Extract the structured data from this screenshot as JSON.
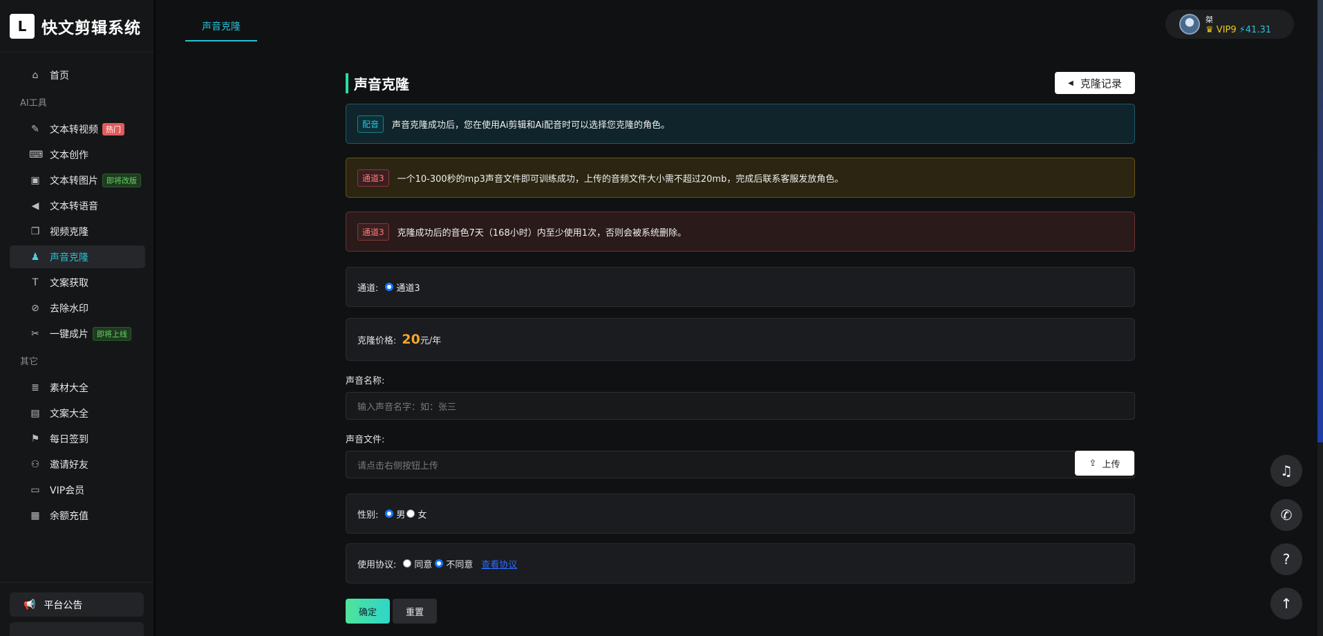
{
  "app": {
    "logo_mark": "L",
    "title": "快文剪辑系统"
  },
  "sidebar": {
    "items": [
      {
        "label": "首页",
        "icon": "home-icon",
        "glyph": "⌂"
      },
      {
        "group": "AI工具"
      },
      {
        "label": "文本转视频",
        "icon": "magic-wand-icon",
        "glyph": "✎",
        "badge": "热门",
        "badge_type": "hot"
      },
      {
        "label": "文本创作",
        "icon": "keyboard-icon",
        "glyph": "⌨"
      },
      {
        "label": "文本转图片",
        "icon": "image-icon",
        "glyph": "▣",
        "badge": "即将改版",
        "badge_type": "soon"
      },
      {
        "label": "文本转语音",
        "icon": "speaker-icon",
        "glyph": "◀"
      },
      {
        "label": "视频克隆",
        "icon": "copy-icon",
        "glyph": "❐"
      },
      {
        "label": "声音克隆",
        "icon": "users-icon",
        "glyph": "♟",
        "active": true
      },
      {
        "label": "文案获取",
        "icon": "text-height-icon",
        "glyph": "T"
      },
      {
        "label": "去除水印",
        "icon": "no-droplet-icon",
        "glyph": "⊘"
      },
      {
        "label": "一键成片",
        "icon": "scissors-icon",
        "glyph": "✂",
        "badge": "即将上线",
        "badge_type": "soon"
      },
      {
        "group": "其它"
      },
      {
        "label": "素材大全",
        "icon": "list-icon",
        "glyph": "≣"
      },
      {
        "label": "文案大全",
        "icon": "book-icon",
        "glyph": "▤"
      },
      {
        "label": "每日签到",
        "icon": "flag-icon",
        "glyph": "⚑"
      },
      {
        "label": "邀请好友",
        "icon": "invite-icon",
        "glyph": "⚇"
      },
      {
        "label": "VIP会员",
        "icon": "id-card-icon",
        "glyph": "▭"
      },
      {
        "label": "余额充值",
        "icon": "wallet-icon",
        "glyph": "▦"
      }
    ],
    "notice": "平台公告"
  },
  "tabs": [
    {
      "label": "声音克隆"
    }
  ],
  "user": {
    "name": "桀",
    "vip": "VIP9",
    "balance": "41.31"
  },
  "page": {
    "title": "声音克隆",
    "record_button": "克隆记录",
    "alerts": [
      {
        "tag": "配音",
        "text": "声音克隆成功后，您在使用Ai剪辑和Ai配音时可以选择您克隆的角色。"
      },
      {
        "tag": "通道3",
        "text": "一个10-300秒的mp3声音文件即可训练成功，上传的音频文件大小需不超过20mb，完成后联系客服发放角色。"
      },
      {
        "tag": "通道3",
        "text": "克隆成功后的音色7天（168小时）内至少使用1次，否则会被系统删除。"
      }
    ],
    "channel": {
      "label": "通道:",
      "option": "通道3"
    },
    "price": {
      "label": "克隆价格:",
      "amount": "20",
      "unit": "元/年"
    },
    "voice_name": {
      "label": "声音名称:",
      "placeholder": "输入声音名字：如：张三"
    },
    "voice_file": {
      "label": "声音文件:",
      "placeholder": "请点击右侧按钮上传",
      "upload": "上传"
    },
    "gender": {
      "label": "性别:",
      "male": "男",
      "female": "女"
    },
    "agreement": {
      "label": "使用协议:",
      "agree": "同意",
      "disagree": "不同意",
      "link": "查看协议"
    },
    "confirm": "确定",
    "reset": "重置"
  },
  "float_buttons": [
    {
      "name": "music-icon",
      "glyph": "♫"
    },
    {
      "name": "wechat-icon",
      "glyph": "✆"
    },
    {
      "name": "help-icon",
      "glyph": "?"
    },
    {
      "name": "arrow-up-icon",
      "glyph": "↑"
    }
  ],
  "colors": {
    "accent": "#27c2d6",
    "price": "#f5a623",
    "confirm_start": "#4fe39b",
    "confirm_end": "#2fd6c8"
  }
}
